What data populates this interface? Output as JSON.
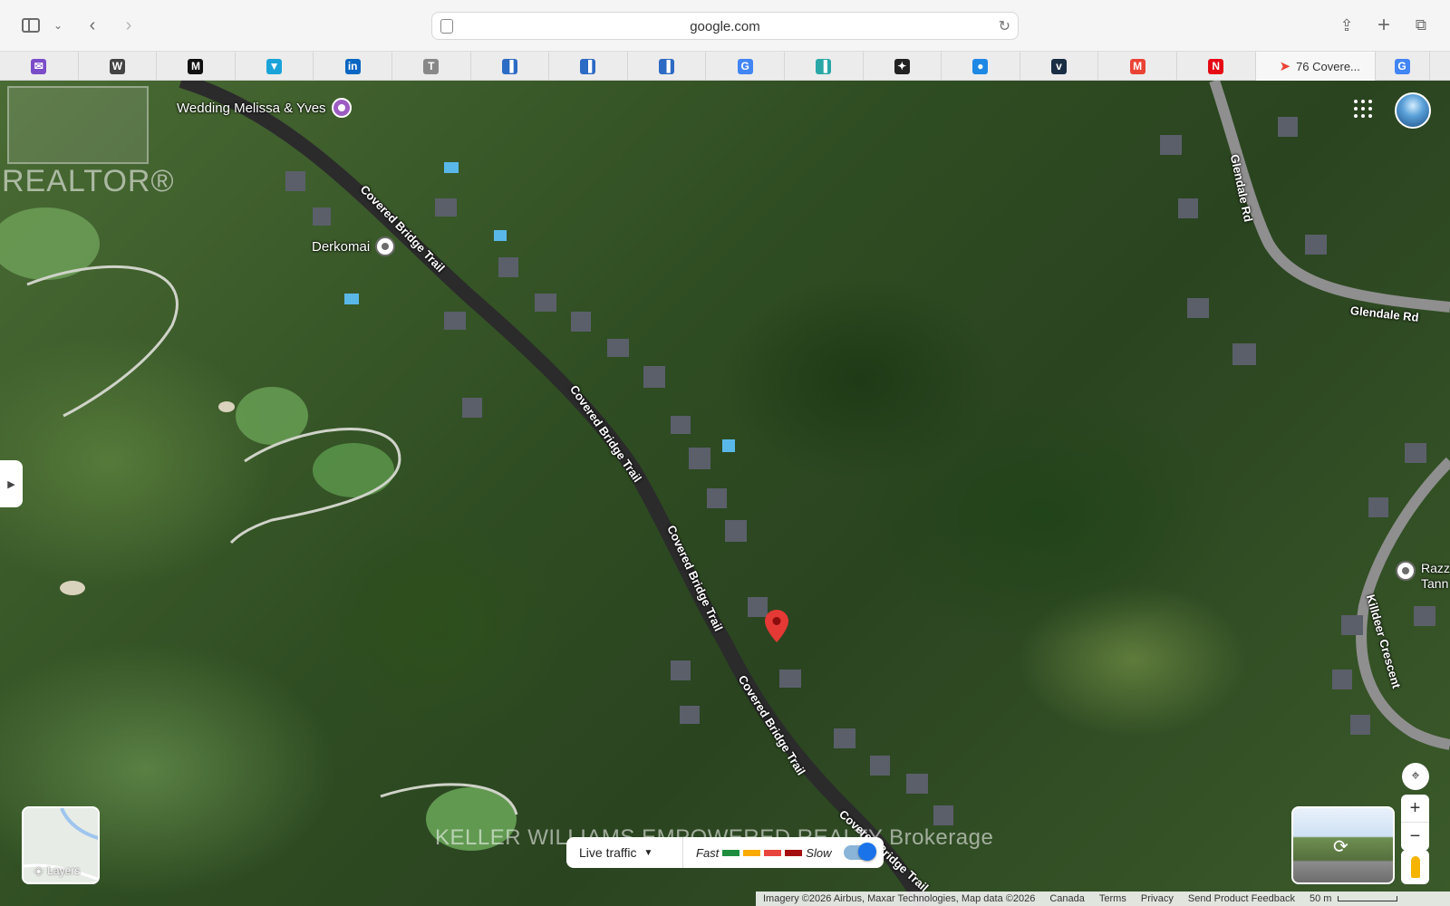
{
  "browser": {
    "url": "google.com",
    "favorites": [
      {
        "icon": "proton-icon",
        "color": "#7b4cc9",
        "glyph": "✉"
      },
      {
        "icon": "wordpress-icon",
        "color": "#444444",
        "glyph": "W"
      },
      {
        "icon": "medium-icon",
        "color": "#111111",
        "glyph": "M"
      },
      {
        "icon": "vimeo-triangle-icon",
        "color": "#1aa3d9",
        "glyph": "▼"
      },
      {
        "icon": "linkedin-icon",
        "color": "#0a66c2",
        "glyph": "in"
      },
      {
        "icon": "t-icon",
        "color": "#888888",
        "glyph": "T"
      },
      {
        "icon": "buildings-icon",
        "color": "#2d6bc4",
        "glyph": "▐"
      },
      {
        "icon": "buildings-icon",
        "color": "#2d6bc4",
        "glyph": "▐"
      },
      {
        "icon": "buildings-icon",
        "color": "#2d6bc4",
        "glyph": "▐"
      },
      {
        "icon": "google-icon",
        "color": "#4285f4",
        "glyph": "G"
      },
      {
        "icon": "building-teal-icon",
        "color": "#2aa7a7",
        "glyph": "▐"
      },
      {
        "icon": "openai-icon",
        "color": "#222222",
        "glyph": "✦"
      },
      {
        "icon": "drop-icon",
        "color": "#1e88e5",
        "glyph": "●"
      },
      {
        "icon": "vimeo-icon",
        "color": "#1a2e44",
        "glyph": "v"
      },
      {
        "icon": "gmail-icon",
        "color": "#ea4335",
        "glyph": "M"
      },
      {
        "icon": "netflix-icon",
        "color": "#e50914",
        "glyph": "N"
      }
    ],
    "active_tab": {
      "icon": "maps-pin-icon",
      "title": "76 Covere..."
    },
    "last_tab": {
      "icon": "google-icon",
      "glyph": "G"
    }
  },
  "map": {
    "watermark_logo_text": "REALTOR®",
    "watermark_brokerage": "KELLER WILLIAMS EMPOWERED REALTY Brokerage",
    "roads": {
      "covered_bridge": "Covered Bridge Trail",
      "glendale": "Glendale Rd",
      "killdeer": "Killdeer Crescent"
    },
    "pois": {
      "wedding": "Wedding Melissa & Yves",
      "derkomai": "Derkomai",
      "razz": "Razz\nTann"
    },
    "layers_label": "Layers",
    "traffic": {
      "label": "Live traffic",
      "fast": "Fast",
      "slow": "Slow",
      "colors": [
        "#1e8e3e",
        "#f9ab00",
        "#e8453c",
        "#a50e0e"
      ]
    },
    "footer": {
      "imagery": "Imagery ©2026 Airbus, Maxar Technologies, Map data ©2026",
      "canada": "Canada",
      "terms": "Terms",
      "privacy": "Privacy",
      "feedback": "Send Product Feedback",
      "scale": "50 m"
    }
  }
}
